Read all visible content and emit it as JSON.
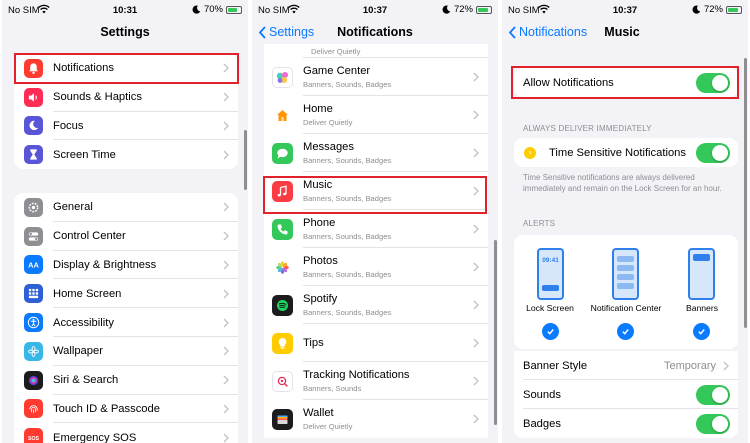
{
  "panel1": {
    "status": {
      "carrier": "No SIM",
      "time": "10:31",
      "battery": "70%",
      "battery_level": 0.7
    },
    "title": "Settings",
    "group1": [
      {
        "label": "Notifications",
        "icon": "bell-icon",
        "color": "#ff3b30"
      },
      {
        "label": "Sounds & Haptics",
        "icon": "speaker-icon",
        "color": "#ff2d55"
      },
      {
        "label": "Focus",
        "icon": "moon-icon",
        "color": "#5856d6"
      },
      {
        "label": "Screen Time",
        "icon": "hourglass-icon",
        "color": "#5856d6"
      }
    ],
    "group2": [
      {
        "label": "General",
        "icon": "gear-icon",
        "color": "#8e8e93"
      },
      {
        "label": "Control Center",
        "icon": "toggles-icon",
        "color": "#8e8e93"
      },
      {
        "label": "Display & Brightness",
        "icon": "aa-icon",
        "color": "#0a7aff"
      },
      {
        "label": "Home Screen",
        "icon": "grid-icon",
        "color": "#2f5fd6"
      },
      {
        "label": "Accessibility",
        "icon": "accessibility-icon",
        "color": "#0a7aff"
      },
      {
        "label": "Wallpaper",
        "icon": "flower-icon",
        "color": "#38b6e8"
      },
      {
        "label": "Siri & Search",
        "icon": "siri-icon",
        "color": "#1c1c1e"
      },
      {
        "label": "Touch ID & Passcode",
        "icon": "fingerprint-icon",
        "color": "#ff3b30"
      },
      {
        "label": "Emergency SOS",
        "icon": "sos-icon",
        "color": "#ff3b30"
      }
    ]
  },
  "panel2": {
    "status": {
      "carrier": "No SIM",
      "time": "10:37",
      "battery": "72%",
      "battery_level": 0.72
    },
    "back": "Settings",
    "title": "Notifications",
    "partial_sub": "Deliver Quietly",
    "apps": [
      {
        "name": "Game Center",
        "sub": "Banners, Sounds, Badges",
        "icon": "game-center-icon",
        "color": "#ffffff"
      },
      {
        "name": "Home",
        "sub": "Deliver Quietly",
        "icon": "home-icon",
        "color": "#ffffff"
      },
      {
        "name": "Messages",
        "sub": "Banners, Sounds, Badges",
        "icon": "messages-icon",
        "color": "#34c759"
      },
      {
        "name": "Music",
        "sub": "Banners, Sounds, Badges",
        "icon": "music-icon",
        "color": "#fc3c44"
      },
      {
        "name": "Phone",
        "sub": "Banners, Sounds, Badges",
        "icon": "phone-icon",
        "color": "#34c759"
      },
      {
        "name": "Photos",
        "sub": "Banners, Sounds, Badges",
        "icon": "photos-icon",
        "color": "#ffffff"
      },
      {
        "name": "Spotify",
        "sub": "Banners, Sounds, Badges",
        "icon": "spotify-icon",
        "color": "#1c1c1e"
      },
      {
        "name": "Tips",
        "sub": "",
        "icon": "tips-icon",
        "color": "#ffcc00"
      },
      {
        "name": "Tracking Notifications",
        "sub": "Banners, Sounds",
        "icon": "tracking-icon",
        "color": "#ffffff"
      },
      {
        "name": "Wallet",
        "sub": "Deliver Quietly",
        "icon": "wallet-icon",
        "color": "#1c1c1e"
      }
    ]
  },
  "panel3": {
    "status": {
      "carrier": "No SIM",
      "time": "10:37",
      "battery": "72%",
      "battery_level": 0.72
    },
    "back": "Notifications",
    "title": "Music",
    "allow_label": "Allow Notifications",
    "allow_on": true,
    "always_header": "ALWAYS DELIVER IMMEDIATELY",
    "time_sensitive_label": "Time Sensitive Notifications",
    "time_sensitive_on": true,
    "time_sensitive_note": "Time Sensitive notifications are always delivered immediately and remain on the Lock Screen for an hour.",
    "alerts_header": "ALERTS",
    "alert_styles": [
      {
        "label": "Lock Screen",
        "checked": true
      },
      {
        "label": "Notification Center",
        "checked": true
      },
      {
        "label": "Banners",
        "checked": true
      }
    ],
    "lock_time": "09:41",
    "banner_style_label": "Banner Style",
    "banner_style_value": "Temporary",
    "sounds_label": "Sounds",
    "sounds_on": true,
    "badges_label": "Badges",
    "badges_on": true
  },
  "colors": {
    "accent": "#0a7aff",
    "toggle_on": "#34c759",
    "highlight": "#e2222b"
  }
}
